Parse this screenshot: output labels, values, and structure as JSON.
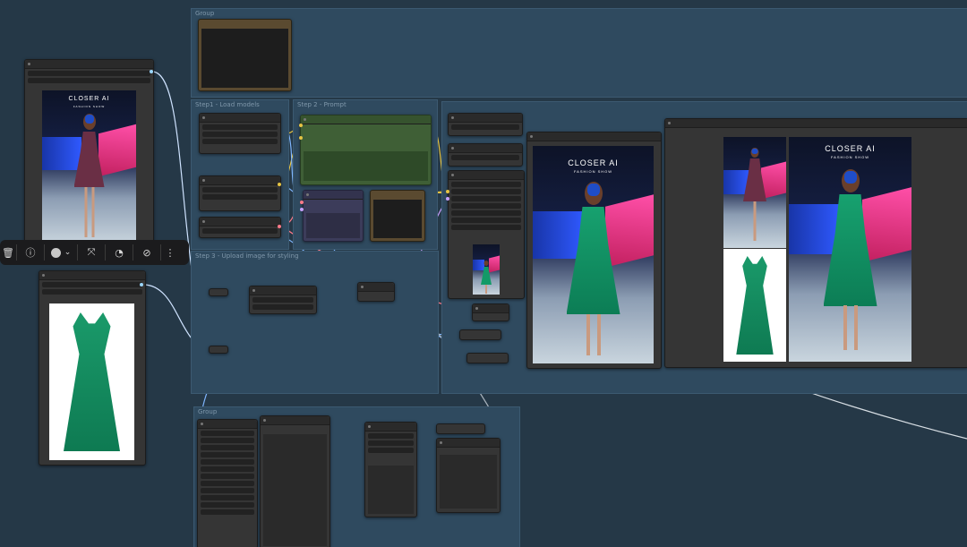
{
  "groups": {
    "top": "Group",
    "load_models": "Step1 - Load models",
    "prompt": "Step 2 - Prompt",
    "upload": "Step 3 - Upload image for styling",
    "bottom": "Group"
  },
  "images": {
    "poster_title": "CLOSER AI",
    "poster_subtitle": "FASHION SHOW",
    "poster_logo_letter": "C"
  },
  "toolbar": {
    "delete": "🗑",
    "info": "ⓘ",
    "color_arrow": "⌄",
    "fit": "⤧",
    "gauge": "◔",
    "bypass": "⊘",
    "more": "⋮"
  },
  "colors": {
    "bg": "#253847",
    "group": "#2f4a5f",
    "node": "#353535",
    "wire_blue": "#7fb6ff",
    "wire_pink": "#ff7a8a",
    "wire_yellow": "#e6c443",
    "wire_lilac": "#c7a0ff"
  }
}
